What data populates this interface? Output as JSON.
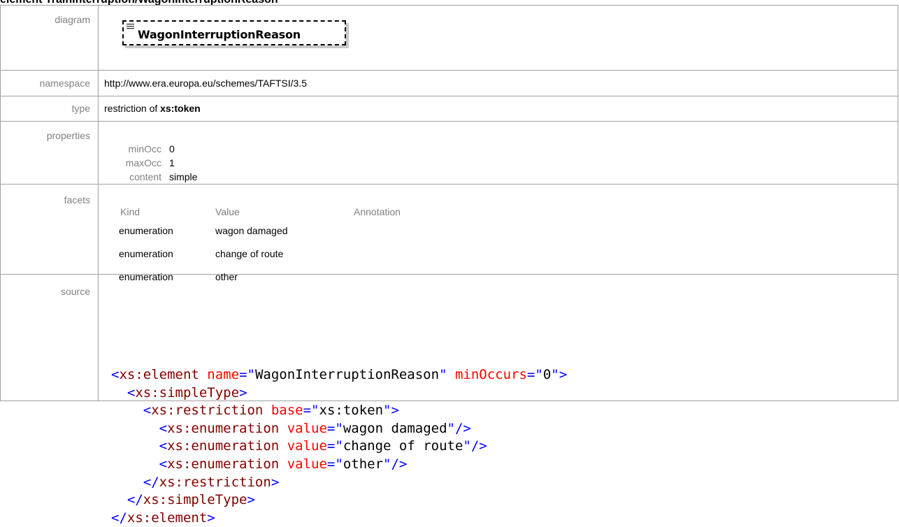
{
  "page_title": "element TrainInterruption/WagonInterruptionReason",
  "rows": {
    "diagram": {
      "label": "diagram",
      "element_name": "WagonInterruptionReason"
    },
    "namespace": {
      "label": "namespace",
      "value": "http://www.era.europa.eu/schemes/TAFTSI/3.5"
    },
    "type": {
      "label": "type",
      "prefix": "restriction of ",
      "base": "xs:token"
    },
    "properties": {
      "label": "properties",
      "items": [
        {
          "key": "minOcc",
          "value": "0"
        },
        {
          "key": "maxOcc",
          "value": "1"
        },
        {
          "key": "content",
          "value": "simple"
        }
      ]
    },
    "facets": {
      "label": "facets",
      "headers": [
        "Kind",
        "Value",
        "Annotation"
      ],
      "items": [
        {
          "kind": "enumeration",
          "value": "wagon damaged"
        },
        {
          "kind": "enumeration",
          "value": "change of route"
        },
        {
          "kind": "enumeration",
          "value": "other"
        }
      ]
    },
    "source": {
      "label": "source",
      "lines": [
        "<xs:element name=\"WagonInterruptionReason\" minOccurs=\"0\">",
        "  <xs:simpleType>",
        "    <xs:restriction base=\"xs:token\">",
        "      <xs:enumeration value=\"wagon damaged\"/>",
        "      <xs:enumeration value=\"change of route\"/>",
        "      <xs:enumeration value=\"other\"/>",
        "    </xs:restriction>",
        "  </xs:simpleType>",
        "</xs:element>"
      ]
    }
  },
  "colors": {
    "border": "#a0a0a0",
    "label_text": "#808080",
    "xml_bracket": "#0000ff",
    "xml_tag_name": "#800000",
    "xml_attr_name": "#ff0000",
    "xml_attr_value": "#000000"
  },
  "icons": {
    "diagram_element": "element-diagram-icon"
  }
}
